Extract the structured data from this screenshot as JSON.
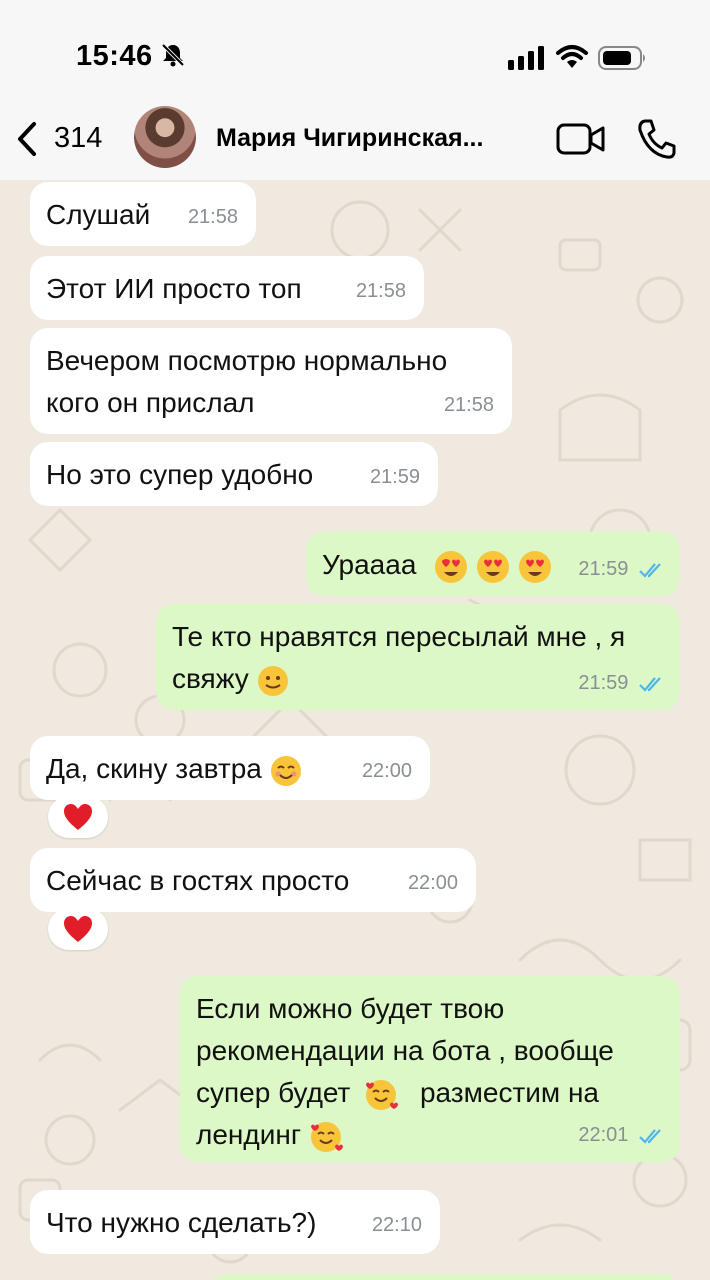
{
  "status_bar": {
    "time": "15:46"
  },
  "header": {
    "back_count": "314",
    "contact_name": "Мария Чигиринская..."
  },
  "messages": [
    {
      "dir": "in",
      "text": "Слушай",
      "time": "21:58"
    },
    {
      "dir": "in",
      "text": "Этот ИИ просто топ",
      "time": "21:58"
    },
    {
      "dir": "in",
      "text": "Вечером посмотрю нормально кого он прислал",
      "time": "21:58"
    },
    {
      "dir": "in",
      "text": "Но это супер удобно",
      "time": "21:59"
    },
    {
      "dir": "out",
      "text": "Ураааа",
      "time": "21:59",
      "emoji": "heart-eyes x3"
    },
    {
      "dir": "out",
      "text": "Те кто нравятся пересылай мне , я свяжу",
      "time": "21:59",
      "emoji": "slight-smile"
    },
    {
      "dir": "in",
      "text": "Да, скину завтра",
      "time": "22:00",
      "emoji": "smile",
      "reaction": "red-heart"
    },
    {
      "dir": "in",
      "text": "Сейчас в гостях просто",
      "time": "22:00",
      "reaction": "red-heart"
    },
    {
      "dir": "out",
      "text_1": "Если можно будет твою",
      "text_2": "рекомендации  на бота , вообще",
      "text_3": "супер будет",
      "text_4": "разместим на",
      "text_5": "лендинг",
      "time": "22:01",
      "emoji": "smiling-face-with-hearts"
    },
    {
      "dir": "in",
      "text": "Что нужно сделать?)",
      "time": "22:10"
    }
  ],
  "colors": {
    "incoming": "#ffffff",
    "outgoing": "#dcf8c6",
    "ticks": "#4fb6ec",
    "background": "#efe9e0"
  }
}
